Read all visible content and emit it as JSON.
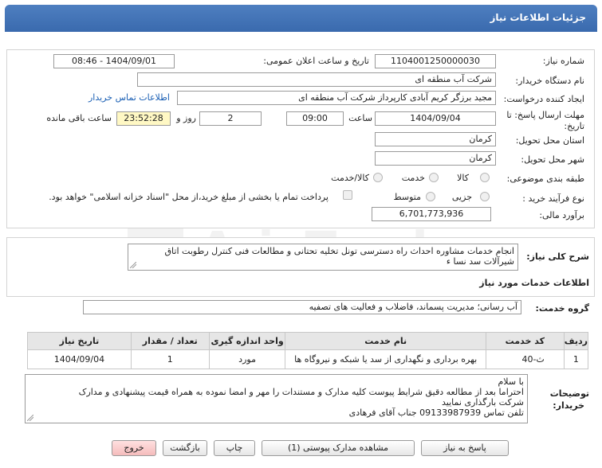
{
  "header": {
    "title": "جزئیات اطلاعات نیاز"
  },
  "need_info": {
    "need_number_label": "شماره نیاز:",
    "need_number": "1104001250000030",
    "announce_label": "تاریخ و ساعت اعلان عمومی:",
    "announce_value": "1404/09/01 - 08:46",
    "buyer_org_label": "نام دستگاه خریدار:",
    "buyer_org": "شرکت آب منطقه ای",
    "creator_label": "ایجاد کننده درخواست:",
    "creator": "مجید  برزگر کریم آبادی کارپرداز شرکت آب منطقه ای",
    "contact_link": "اطلاعات تماس خریدار",
    "deadline_label_1": "مهلت ارسال پاسخ: تا",
    "deadline_label_2": "تاریخ:",
    "deadline_date": "1404/09/04",
    "time_label": "ساعت",
    "deadline_time": "09:00",
    "days_value": "2",
    "days_label": "روز و",
    "remaining_time": "23:52:28",
    "remaining_label": "ساعت باقی مانده",
    "province_label": "استان محل تحویل:",
    "province": "کرمان",
    "city_label": "شهر محل تحویل:",
    "city": "کرمان",
    "category_label": "طبقه بندی موضوعی:",
    "category_options": [
      "کالا",
      "خدمت",
      "کالا/خدمت"
    ],
    "process_label": "نوع فرآیند خرید :",
    "process_options": [
      "جزیی",
      "متوسط"
    ],
    "payment_note": "پرداخت تمام یا بخشی از مبلغ خرید،از محل \"اسناد خزانه اسلامی\" خواهد بود.",
    "estimate_label": "برآورد مالی:",
    "estimate": "6,701,773,936"
  },
  "description": {
    "label": "شرح کلی نیاز:",
    "text": "انجام خدمات مشاوره احداث راه دسترسی تونل تخلیه تحتانی و مطالعات فنی کنترل رطوبت اتاق شیرآلات سد نسا ء"
  },
  "services": {
    "section_title": "اطلاعات خدمات مورد نیاز",
    "group_label": "گروه خدمت:",
    "group_value": "آب رسانی؛ مدیریت پسماند، فاضلاب و فعالیت های تصفیه",
    "columns": [
      "ردیف",
      "کد خدمت",
      "نام خدمت",
      "واحد اندازه گیری",
      "تعداد / مقدار",
      "تاریخ نیاز"
    ],
    "rows": [
      [
        "1",
        "ث-40",
        "بهره برداری و نگهداری از سد یا شبکه و نیروگاه ها",
        "مورد",
        "1",
        "1404/09/04"
      ]
    ]
  },
  "buyer_notes": {
    "label_1": "توضیحات",
    "label_2": "خریدار:",
    "lines": [
      "با سلام",
      "احتراما بعد از مطالعه دقیق شرایط پیوست کلیه مدارک و مستندات را مهر و امضا نموده به همراه قیمت پیشنهادی و مدارک",
      "شرکت بارگذاری نمایید",
      "تلفن تماس 09133987939 جناب آقای فرهادی"
    ]
  },
  "buttons": {
    "reply": "پاسخ به نیاز",
    "view_docs": "مشاهده مدارک پیوستی (1)",
    "print": "چاپ",
    "back": "بازگشت",
    "exit": "خروج"
  },
  "watermark": "AriaTender.net",
  "colors": {
    "header": "#4e7fc0",
    "link": "#1a5fb4",
    "exit_button": "#f5bcbc",
    "remaining_bg": "#fff8c4"
  }
}
